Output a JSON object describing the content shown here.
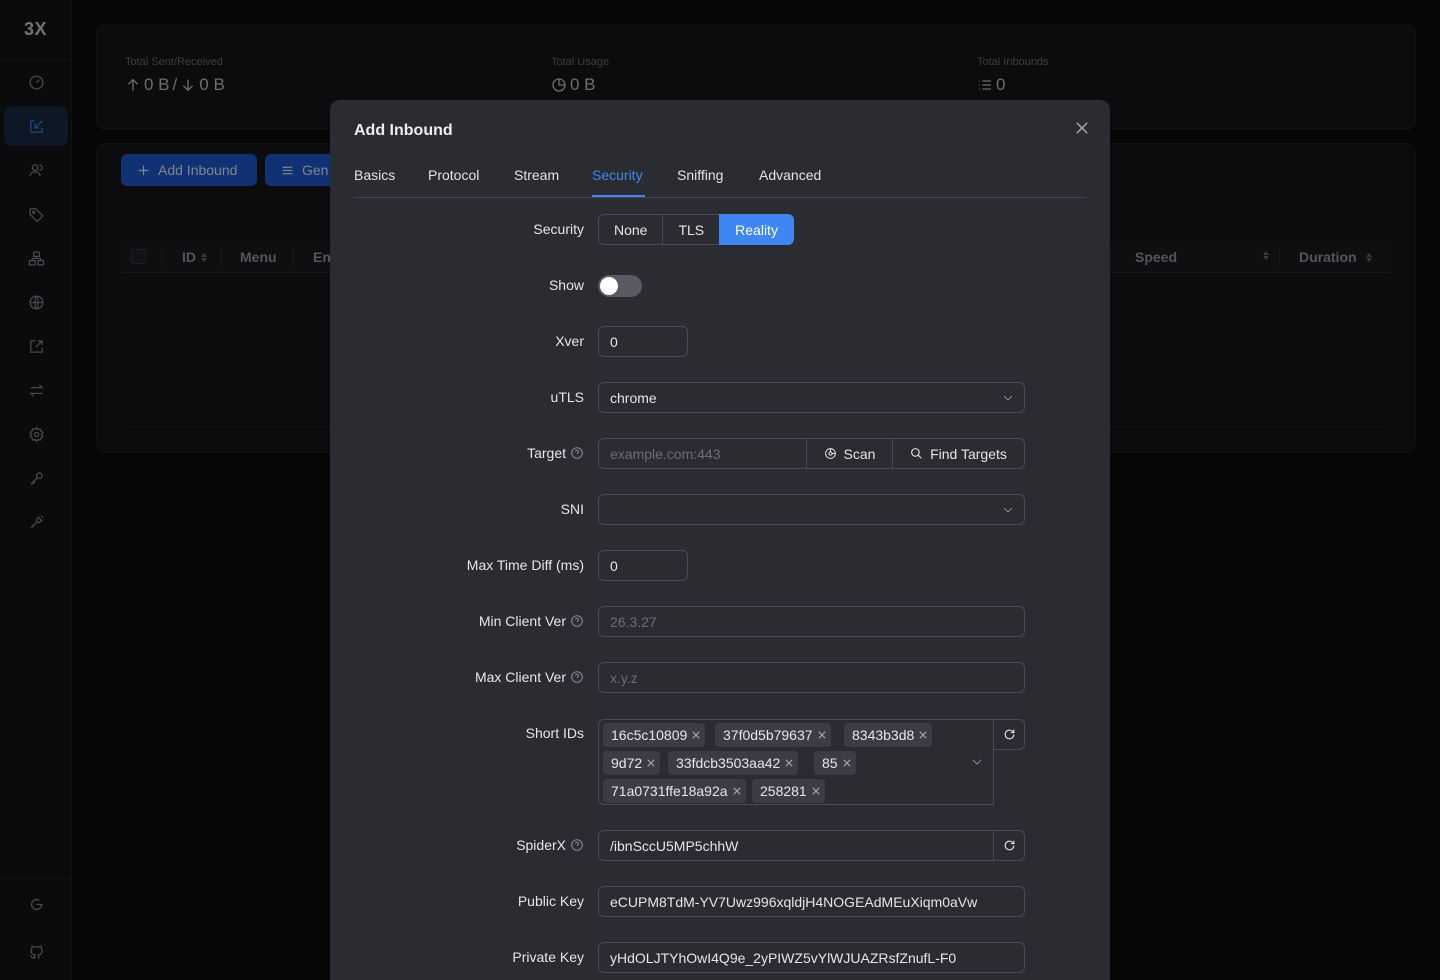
{
  "app": {
    "logo": "3X"
  },
  "sidebar": {
    "items": [
      {
        "icon": "dashboard-icon",
        "active": false
      },
      {
        "icon": "inbounds-icon",
        "active": true
      },
      {
        "icon": "clients-icon",
        "active": false
      },
      {
        "icon": "tag-icon",
        "active": false
      },
      {
        "icon": "nodes-icon",
        "active": false
      },
      {
        "icon": "globe-icon",
        "active": false
      },
      {
        "icon": "export-icon",
        "active": false
      },
      {
        "icon": "swap-icon",
        "active": false
      },
      {
        "icon": "gear-icon",
        "active": false
      },
      {
        "icon": "key-icon",
        "active": false
      },
      {
        "icon": "xray-icon",
        "active": false
      }
    ],
    "bottom": [
      {
        "icon": "logout-icon"
      },
      {
        "icon": "github-icon"
      }
    ]
  },
  "stats": {
    "sent_received_label": "Total Sent/Received",
    "sent_value": "0 B",
    "separator": "/",
    "received_value": "0 B",
    "usage_label": "Total Usage",
    "usage_value": "0 B",
    "inbounds_label": "Total Inbounds",
    "inbounds_value": "0"
  },
  "toolbar": {
    "add_inbound_label": "Add Inbound",
    "general_label": "Gen"
  },
  "table": {
    "columns": [
      "ID",
      "Menu",
      "En",
      "Speed",
      "Duration"
    ]
  },
  "modal": {
    "title": "Add Inbound",
    "tabs": [
      "Basics",
      "Protocol",
      "Stream",
      "Security",
      "Sniffing",
      "Advanced"
    ],
    "active_tab": "Security",
    "security": {
      "label": "Security",
      "options": [
        "None",
        "TLS",
        "Reality"
      ],
      "selected": "Reality"
    },
    "show": {
      "label": "Show",
      "enabled": false
    },
    "xver": {
      "label": "Xver",
      "value": "0"
    },
    "utls": {
      "label": "uTLS",
      "value": "chrome"
    },
    "target": {
      "label": "Target",
      "placeholder": "example.com:443",
      "scan_label": "Scan",
      "find_targets_label": "Find Targets"
    },
    "sni": {
      "label": "SNI",
      "value": ""
    },
    "max_time_diff": {
      "label": "Max Time Diff (ms)",
      "value": "0"
    },
    "min_client_ver": {
      "label": "Min Client Ver",
      "placeholder": "26.3.27"
    },
    "max_client_ver": {
      "label": "Max Client Ver",
      "placeholder": "x.y.z"
    },
    "short_ids": {
      "label": "Short IDs",
      "values": [
        "16c5c10809",
        "37f0d5b79637",
        "8343b3d8",
        "9d72",
        "33fdcb3503aa42",
        "85",
        "71a0731ffe18a92a",
        "258281"
      ]
    },
    "spider_x": {
      "label": "SpiderX",
      "value": "/ibnSccU5MP5chhW"
    },
    "public_key": {
      "label": "Public Key",
      "value": "eCUPM8TdM-YV7Uwz996xqldjH4NOGEAdMEuXiqm0aVw"
    },
    "private_key": {
      "label": "Private Key",
      "value": "yHdOLJTYhOwI4Q9e_2yPIWZ5vYlWJUAZRsfZnufL-F0"
    }
  }
}
